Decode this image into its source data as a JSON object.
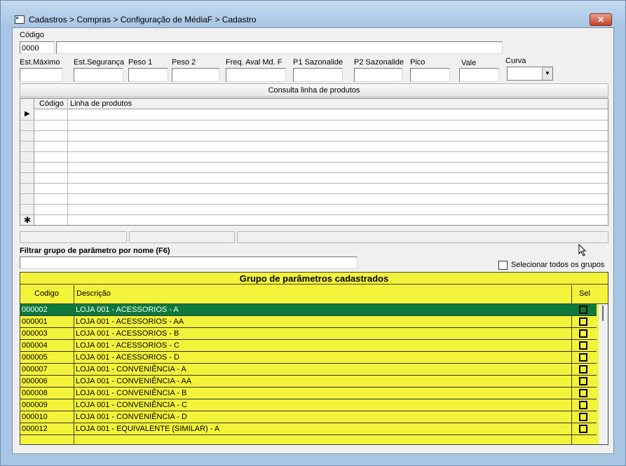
{
  "window": {
    "title": "Cadastros > Compras > Configuração de MédiaF > Cadastro",
    "close_label": "✕"
  },
  "form": {
    "codigo_label": "Código",
    "codigo_value": "0000",
    "descricao_value": "",
    "fields": [
      {
        "label": "Est.Máximo",
        "value": ""
      },
      {
        "label": "Est.Segurança",
        "value": ""
      },
      {
        "label": "Peso 1",
        "value": ""
      },
      {
        "label": "Peso 2",
        "value": ""
      },
      {
        "label": "Freq. Aval Md. F",
        "value": ""
      },
      {
        "label": "P1 Sazonalide",
        "value": ""
      },
      {
        "label": "P2 Sazonalide",
        "value": ""
      },
      {
        "label": "Pico",
        "value": ""
      },
      {
        "label": "Vale",
        "value": ""
      }
    ],
    "curva_label": "Curva",
    "curva_value": ""
  },
  "consulta_button": "Consulta linha de produtos",
  "grid_produtos": {
    "columns": [
      "Código",
      "Linha de produtos"
    ],
    "new_row_marker": "✱",
    "current_row_marker": "▶"
  },
  "filter": {
    "label": "Filtrar grupo de parâmetro por nome (F6)",
    "value": "",
    "select_all_label": "Selecionar todos os grupos"
  },
  "grupos": {
    "title": "Grupo de parâmetros cadastrados",
    "columns": [
      "Codigo",
      "Descrição",
      "Sel"
    ],
    "rows": [
      {
        "codigo": "000002",
        "descricao": "LOJA 001 - ACESSORIOS - A",
        "selected_row": true
      },
      {
        "codigo": "000001",
        "descricao": "LOJA 001 - ACESSORIOS - AA"
      },
      {
        "codigo": "000003",
        "descricao": "LOJA 001 - ACESSORIOS - B"
      },
      {
        "codigo": "000004",
        "descricao": "LOJA 001 - ACESSORIOS - C"
      },
      {
        "codigo": "000005",
        "descricao": "LOJA 001 - ACESSORIOS - D"
      },
      {
        "codigo": "000007",
        "descricao": "LOJA 001 - CONVENIÊNCIA - A"
      },
      {
        "codigo": "000006",
        "descricao": "LOJA 001 - CONVENIÊNCIA - AA"
      },
      {
        "codigo": "000008",
        "descricao": "LOJA 001 - CONVENIÊNCIA - B"
      },
      {
        "codigo": "000009",
        "descricao": "LOJA 001 - CONVENIÊNCIA - C"
      },
      {
        "codigo": "000010",
        "descricao": "LOJA 001 - CONVENIÊNCIA - D"
      },
      {
        "codigo": "000012",
        "descricao": "LOJA 001 - EQUIVALENTE (SIMILAR) - A"
      }
    ],
    "selected_row_color": "#0b7a3a",
    "panel_color": "#f3f33a"
  }
}
